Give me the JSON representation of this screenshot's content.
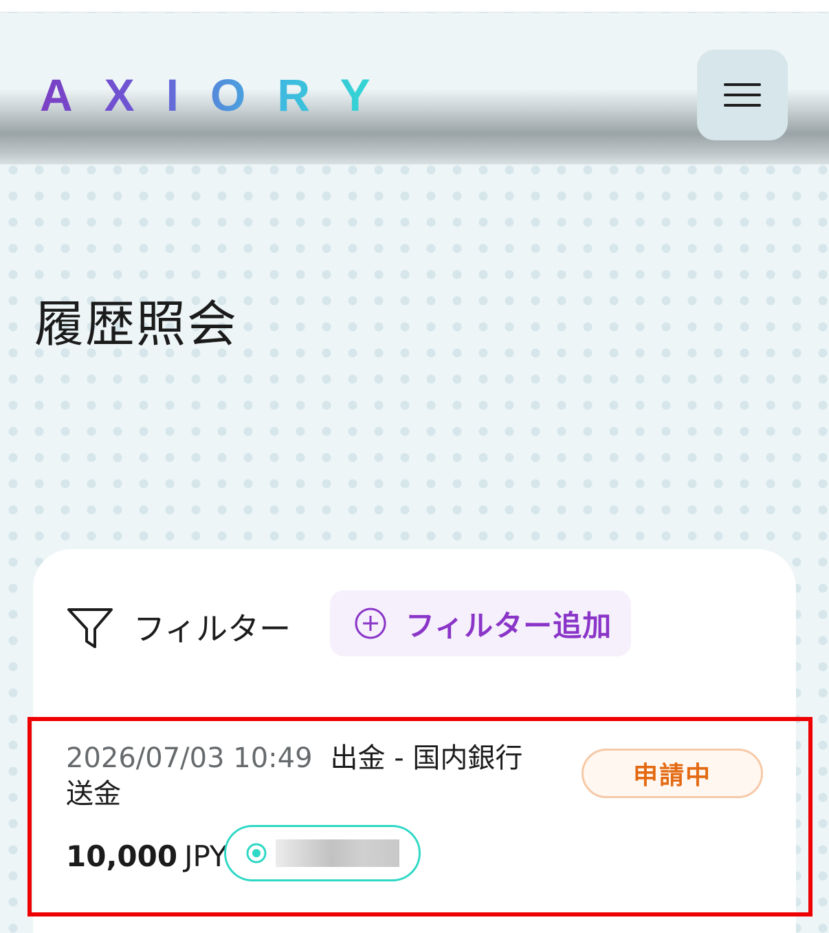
{
  "header": {
    "logo_text": "AXIORY",
    "menu_icon": "hamburger-menu-icon"
  },
  "page": {
    "title": "履歴照会"
  },
  "filters": {
    "label": "フィルター",
    "filter_icon": "funnel-icon",
    "add_button_label": "フィルター追加",
    "add_icon": "plus-circle-icon"
  },
  "transactions": [
    {
      "datetime": "2026/07/03 10:49",
      "description": "出金 - 国内銀行送金",
      "status": "申請中",
      "amount": "10,000",
      "currency": "JPY",
      "account_icon": "radio-dot-icon"
    }
  ],
  "colors": {
    "accent_purple": "#8a35c8",
    "status_orange": "#e36a12",
    "account_teal": "#2dd8c4",
    "highlight_red": "#ee0000"
  }
}
